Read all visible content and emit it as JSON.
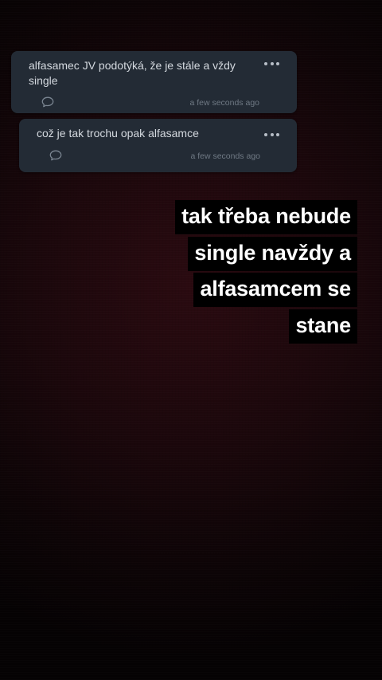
{
  "comments": [
    {
      "text": "alfasamec JV podotýká, že je stále a vždy single",
      "timestamp": "a few seconds ago",
      "more_icon": "more-horizontal-icon",
      "reply_icon": "speech-bubble-icon"
    },
    {
      "text": "což je tak trochu opak alfasamce",
      "timestamp": "a few seconds ago",
      "more_icon": "more-horizontal-icon",
      "reply_icon": "speech-bubble-icon"
    }
  ],
  "story": {
    "caption": "tak třeba nebude single navždy a alfasamcem se stane"
  },
  "colors": {
    "card_background": "#232b35",
    "comment_text": "#d4d9df",
    "timestamp_text": "#6f7984",
    "caption_text": "#ffffff",
    "caption_highlight": "#000000",
    "background": "#1a070b"
  }
}
